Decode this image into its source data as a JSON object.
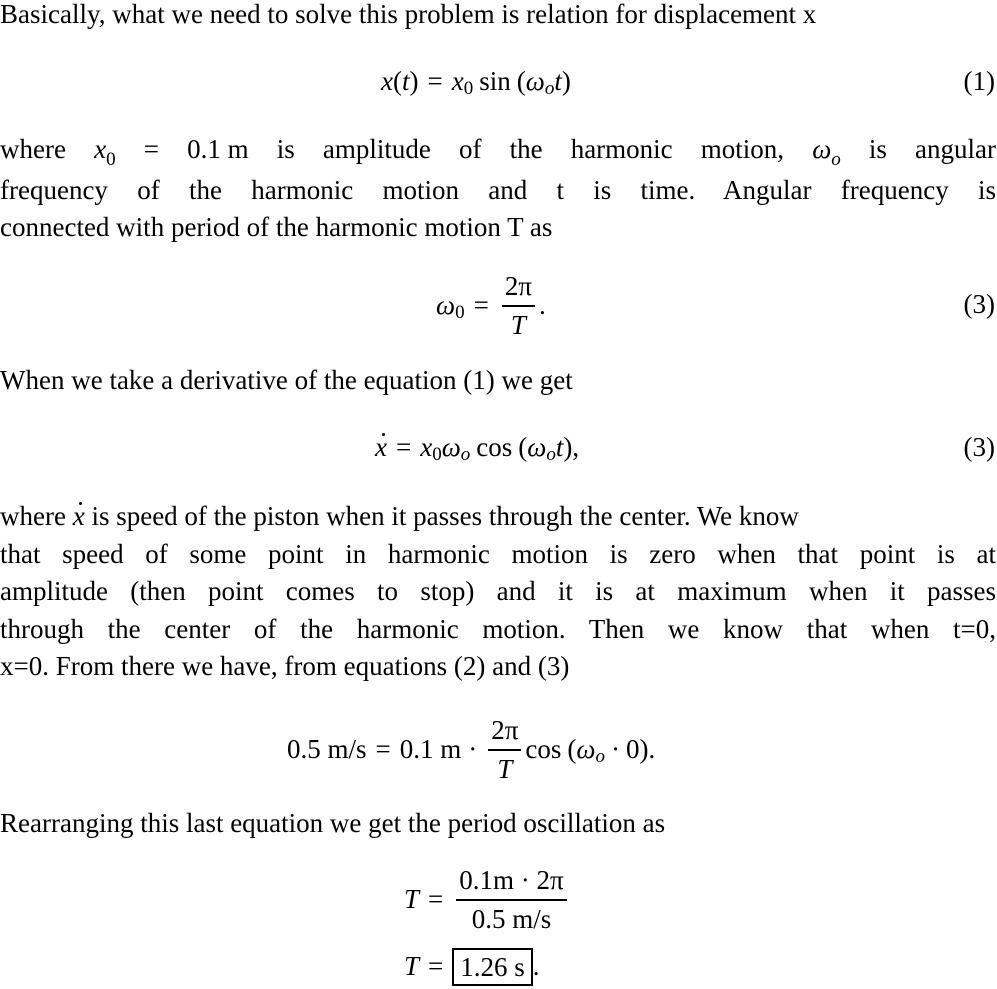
{
  "document": {
    "intro": "Basically, what we need to solve this problem is relation for displacement x",
    "eq1": {
      "lhs_var": "x",
      "lhs_arg": "(t)",
      "equals": "=",
      "amp_var": "x",
      "amp_sub": "0",
      "func": "sin",
      "open": "(",
      "omega": "ω",
      "omega_sub": "o",
      "t": "t",
      "close": ")",
      "number": "(1)"
    },
    "para2": {
      "line1_parts": [
        "where",
        "x",
        "0",
        "=",
        "0.1 m",
        "is",
        "amplitude",
        "of",
        "the",
        "harmonic",
        "motion,",
        "ω",
        "o",
        "is",
        "angular"
      ],
      "line1_pre": "where",
      "line1_var": "x",
      "line1_sub": "0",
      "line1_eq": "=",
      "line1_val": "0.1 m is amplitude of the harmonic motion,",
      "line1_omega": "ω",
      "line1_omega_sub": "o",
      "line1_post": "is angular",
      "line2": "frequency of the harmonic motion and t is time.  Angular frequency is",
      "line3": "connected with period of the harmonic motion T as"
    },
    "eq2": {
      "omega": "ω",
      "omega_sub": "0",
      "equals": "=",
      "num": "2π",
      "den": "T",
      "trail": ".",
      "number": "(3)"
    },
    "para3": "When we take a derivative of the equation (1) we get",
    "eq3": {
      "lhs": "x",
      "equals": "=",
      "x": "x",
      "x_sub": "0",
      "omega": "ω",
      "omega_sub": "o",
      "func": "cos",
      "open": "(",
      "omega2": "ω",
      "omega2_sub": "o",
      "t": "t",
      "close": "),",
      "number": "(3)"
    },
    "para4": {
      "line1_pre": "where",
      "line1_var": "x",
      "line1_post": "is speed of the piston when it passes through the center. We know",
      "line2": "that speed of some point in harmonic motion is zero when that point is at",
      "line3": "amplitude (then point comes to stop) and it is at maximum when it passes",
      "line4": "through the center of the harmonic motion. Then we know that when t=0,",
      "line5": "x=0. From there we have, from equations (2) and (3)"
    },
    "eq4": {
      "lhs": "0.5 m/s",
      "equals": "=",
      "amp": "0.1 m",
      "cdot": "·",
      "num": "2π",
      "den": "T",
      "func": "cos",
      "open": "(",
      "omega": "ω",
      "omega_sub": "o",
      "cdot2": "·",
      "zero": "0",
      "close": ").",
      "number": ""
    },
    "para5": "Rearranging this last equation we get the period oscillation as",
    "eq5": {
      "lhs": "T",
      "equals": "=",
      "num": "0.1m · 2π",
      "den": "0.5 m/s"
    },
    "eq6": {
      "lhs": "T",
      "equals": "=",
      "result": "1.26 s",
      "trail": "."
    }
  }
}
